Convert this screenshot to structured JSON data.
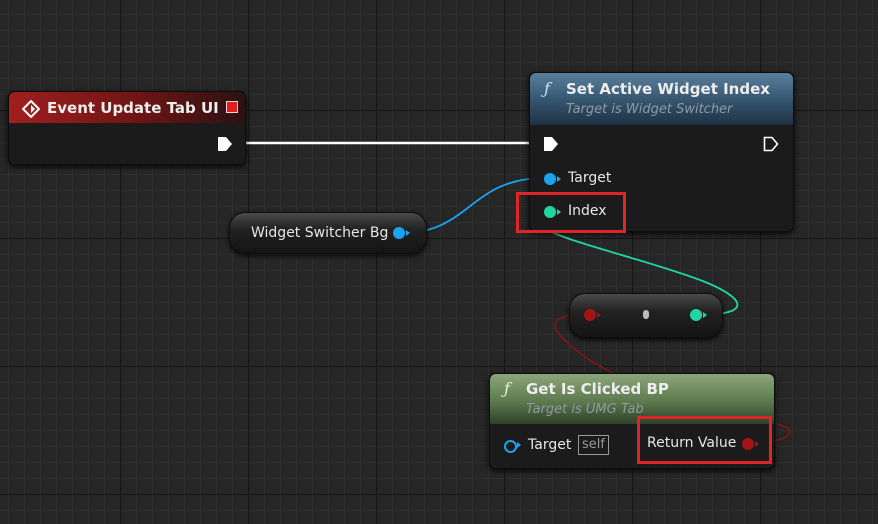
{
  "colors": {
    "exec": "#ffffff",
    "object_pin": "#1aa3f0",
    "int_pin": "#1fd6a3",
    "bool_pin": "#a31515",
    "event_header": "#8b1a1a",
    "function_header": "#3c5c74",
    "pure_header": "#6f8a5e",
    "highlight": "#e0242b"
  },
  "event_node": {
    "title": "Event Update Tab UI",
    "icon": "event-diamond-icon"
  },
  "set_node": {
    "title": "Set Active Widget Index",
    "subtitle": "Target is Widget Switcher",
    "icon": "function-f-icon",
    "pins": {
      "target": "Target",
      "index": "Index"
    }
  },
  "variable_node": {
    "label": "Widget Switcher Bg"
  },
  "convert_node": {
    "icon": "conversion-dot-icon"
  },
  "get_node": {
    "title": "Get Is Clicked BP",
    "subtitle": "Target is UMG Tab",
    "icon": "function-f-icon",
    "pins": {
      "target": "Target",
      "self": "self",
      "return": "Return Value"
    }
  }
}
